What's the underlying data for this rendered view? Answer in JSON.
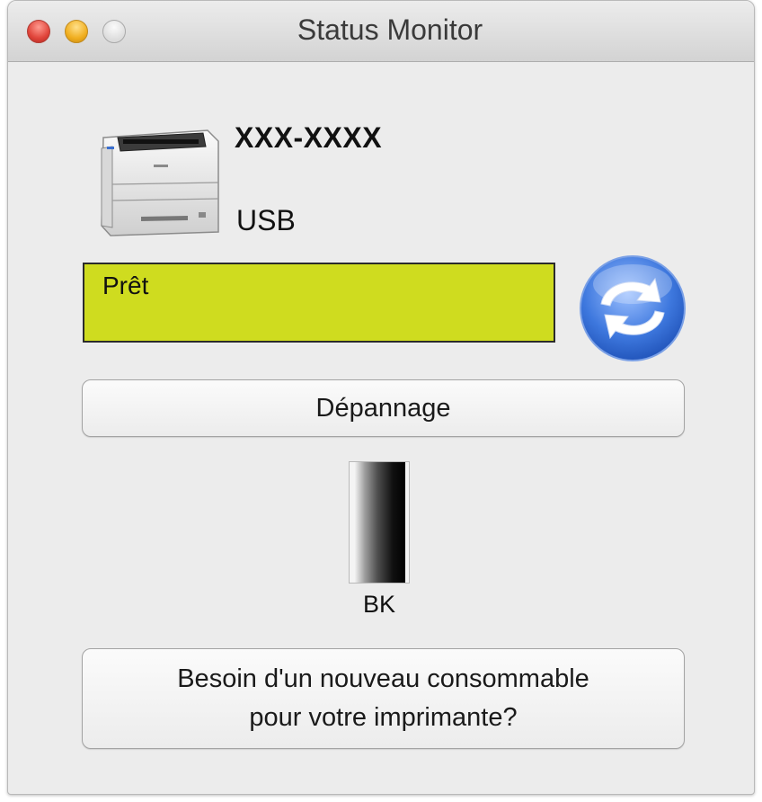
{
  "window": {
    "title": "Status Monitor",
    "buttons": {
      "close": "close",
      "minimize": "minimize",
      "zoom": "zoom"
    }
  },
  "device": {
    "model": "XXX-XXXX",
    "connection": "USB",
    "icon": "printer-icon"
  },
  "status": {
    "text": "Prêt",
    "color": "#cfdc1f"
  },
  "refresh": {
    "icon": "refresh-icon"
  },
  "troubleshooting_label": "Dépannage",
  "toner": {
    "label": "BK",
    "level": 1.0
  },
  "supplies_button": {
    "line1": "Besoin d'un nouveau consommable",
    "line2": "pour votre imprimante?"
  }
}
